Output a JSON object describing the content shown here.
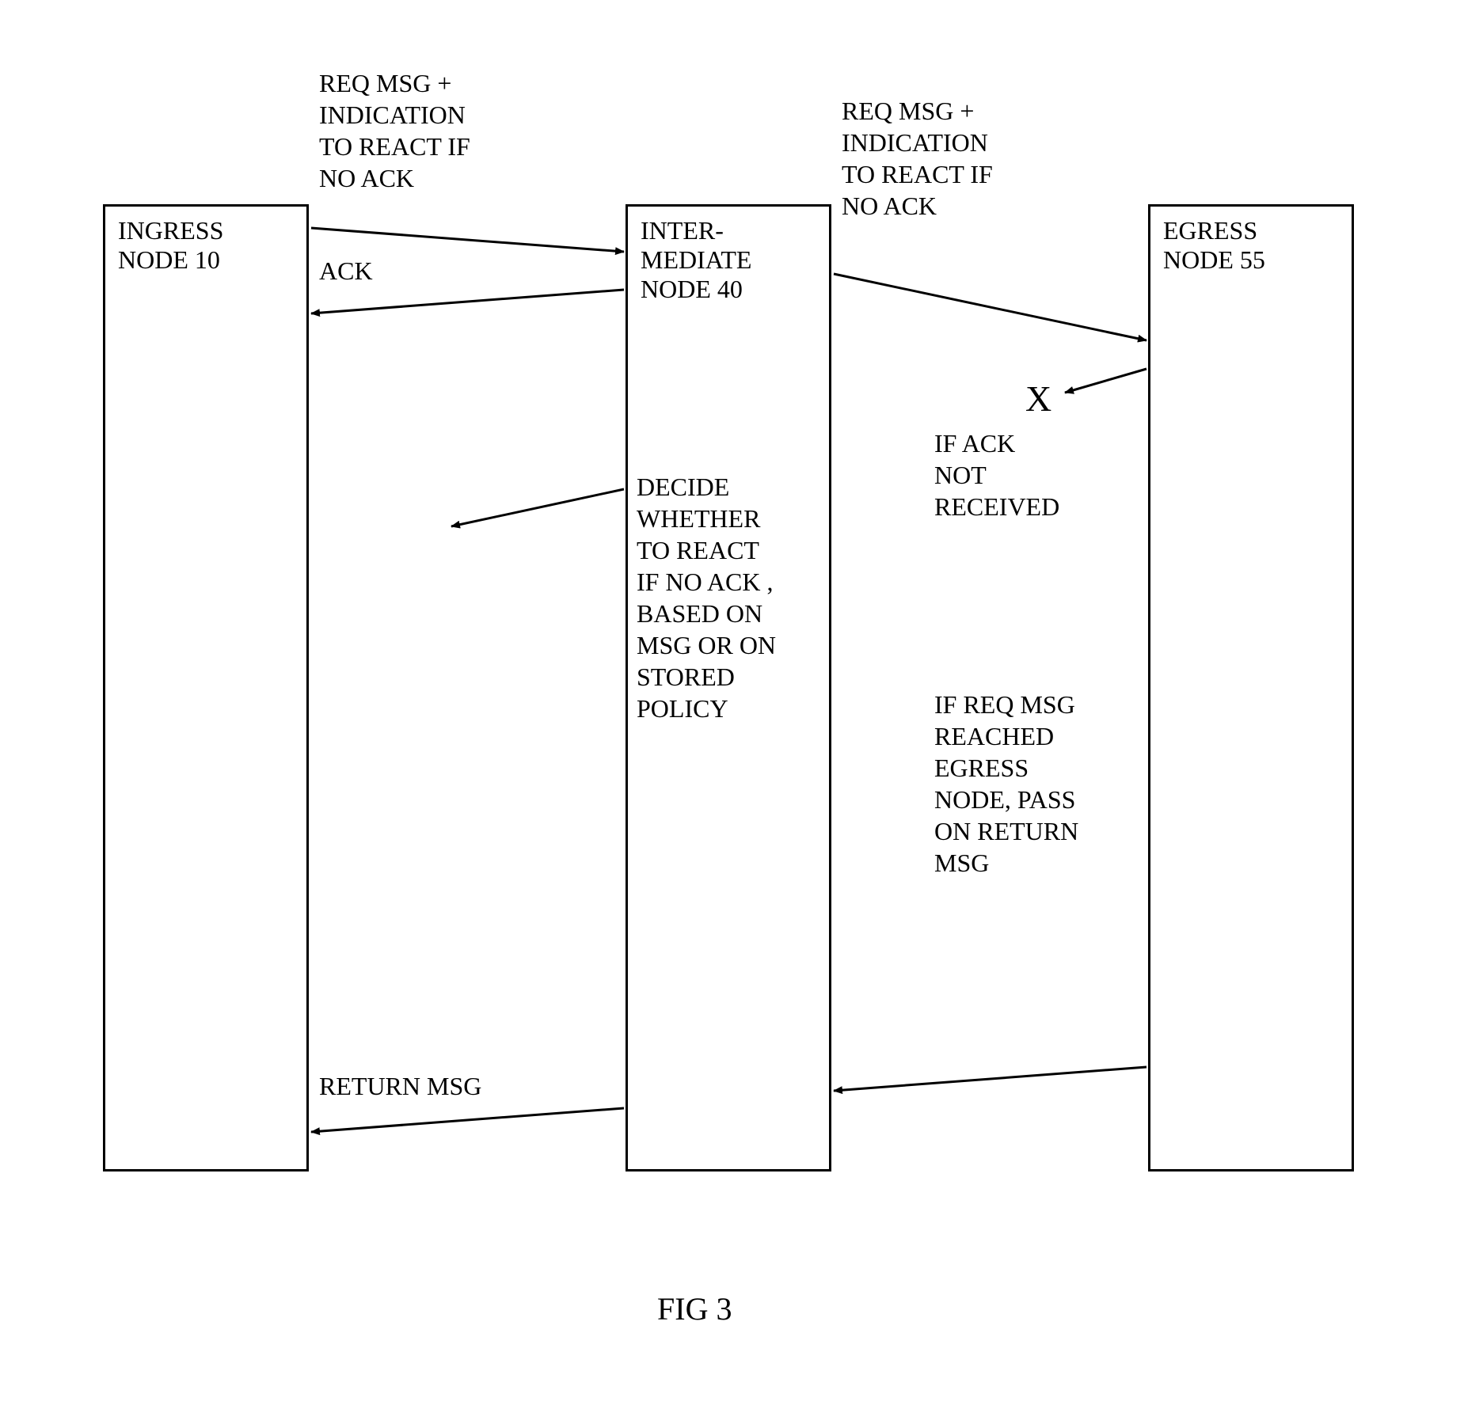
{
  "nodes": {
    "ingress": {
      "line1": "INGRESS",
      "line2": "NODE 10"
    },
    "intermediate": {
      "line1": "INTER-",
      "line2": "MEDIATE",
      "line3": "NODE 40"
    },
    "egress": {
      "line1": "EGRESS",
      "line2": "NODE 55"
    }
  },
  "labels": {
    "req1": "REQ MSG +\nINDICATION\nTO REACT IF\nNO ACK",
    "req2": "REQ MSG +\nINDICATION\nTO REACT IF\nNO ACK",
    "ack": "ACK",
    "fail_mark": "X",
    "ack_not_received": "IF ACK\nNOT\nRECEIVED",
    "decide": "DECIDE\nWHETHER\nTO REACT\nIF NO ACK ,\nBASED ON\nMSG OR ON\nSTORED\nPOLICY",
    "egress_pass": "IF REQ MSG\nREACHED\nEGRESS\nNODE, PASS\nON RETURN\nMSG",
    "return_msg": "RETURN MSG"
  },
  "figure_caption": "FIG 3"
}
